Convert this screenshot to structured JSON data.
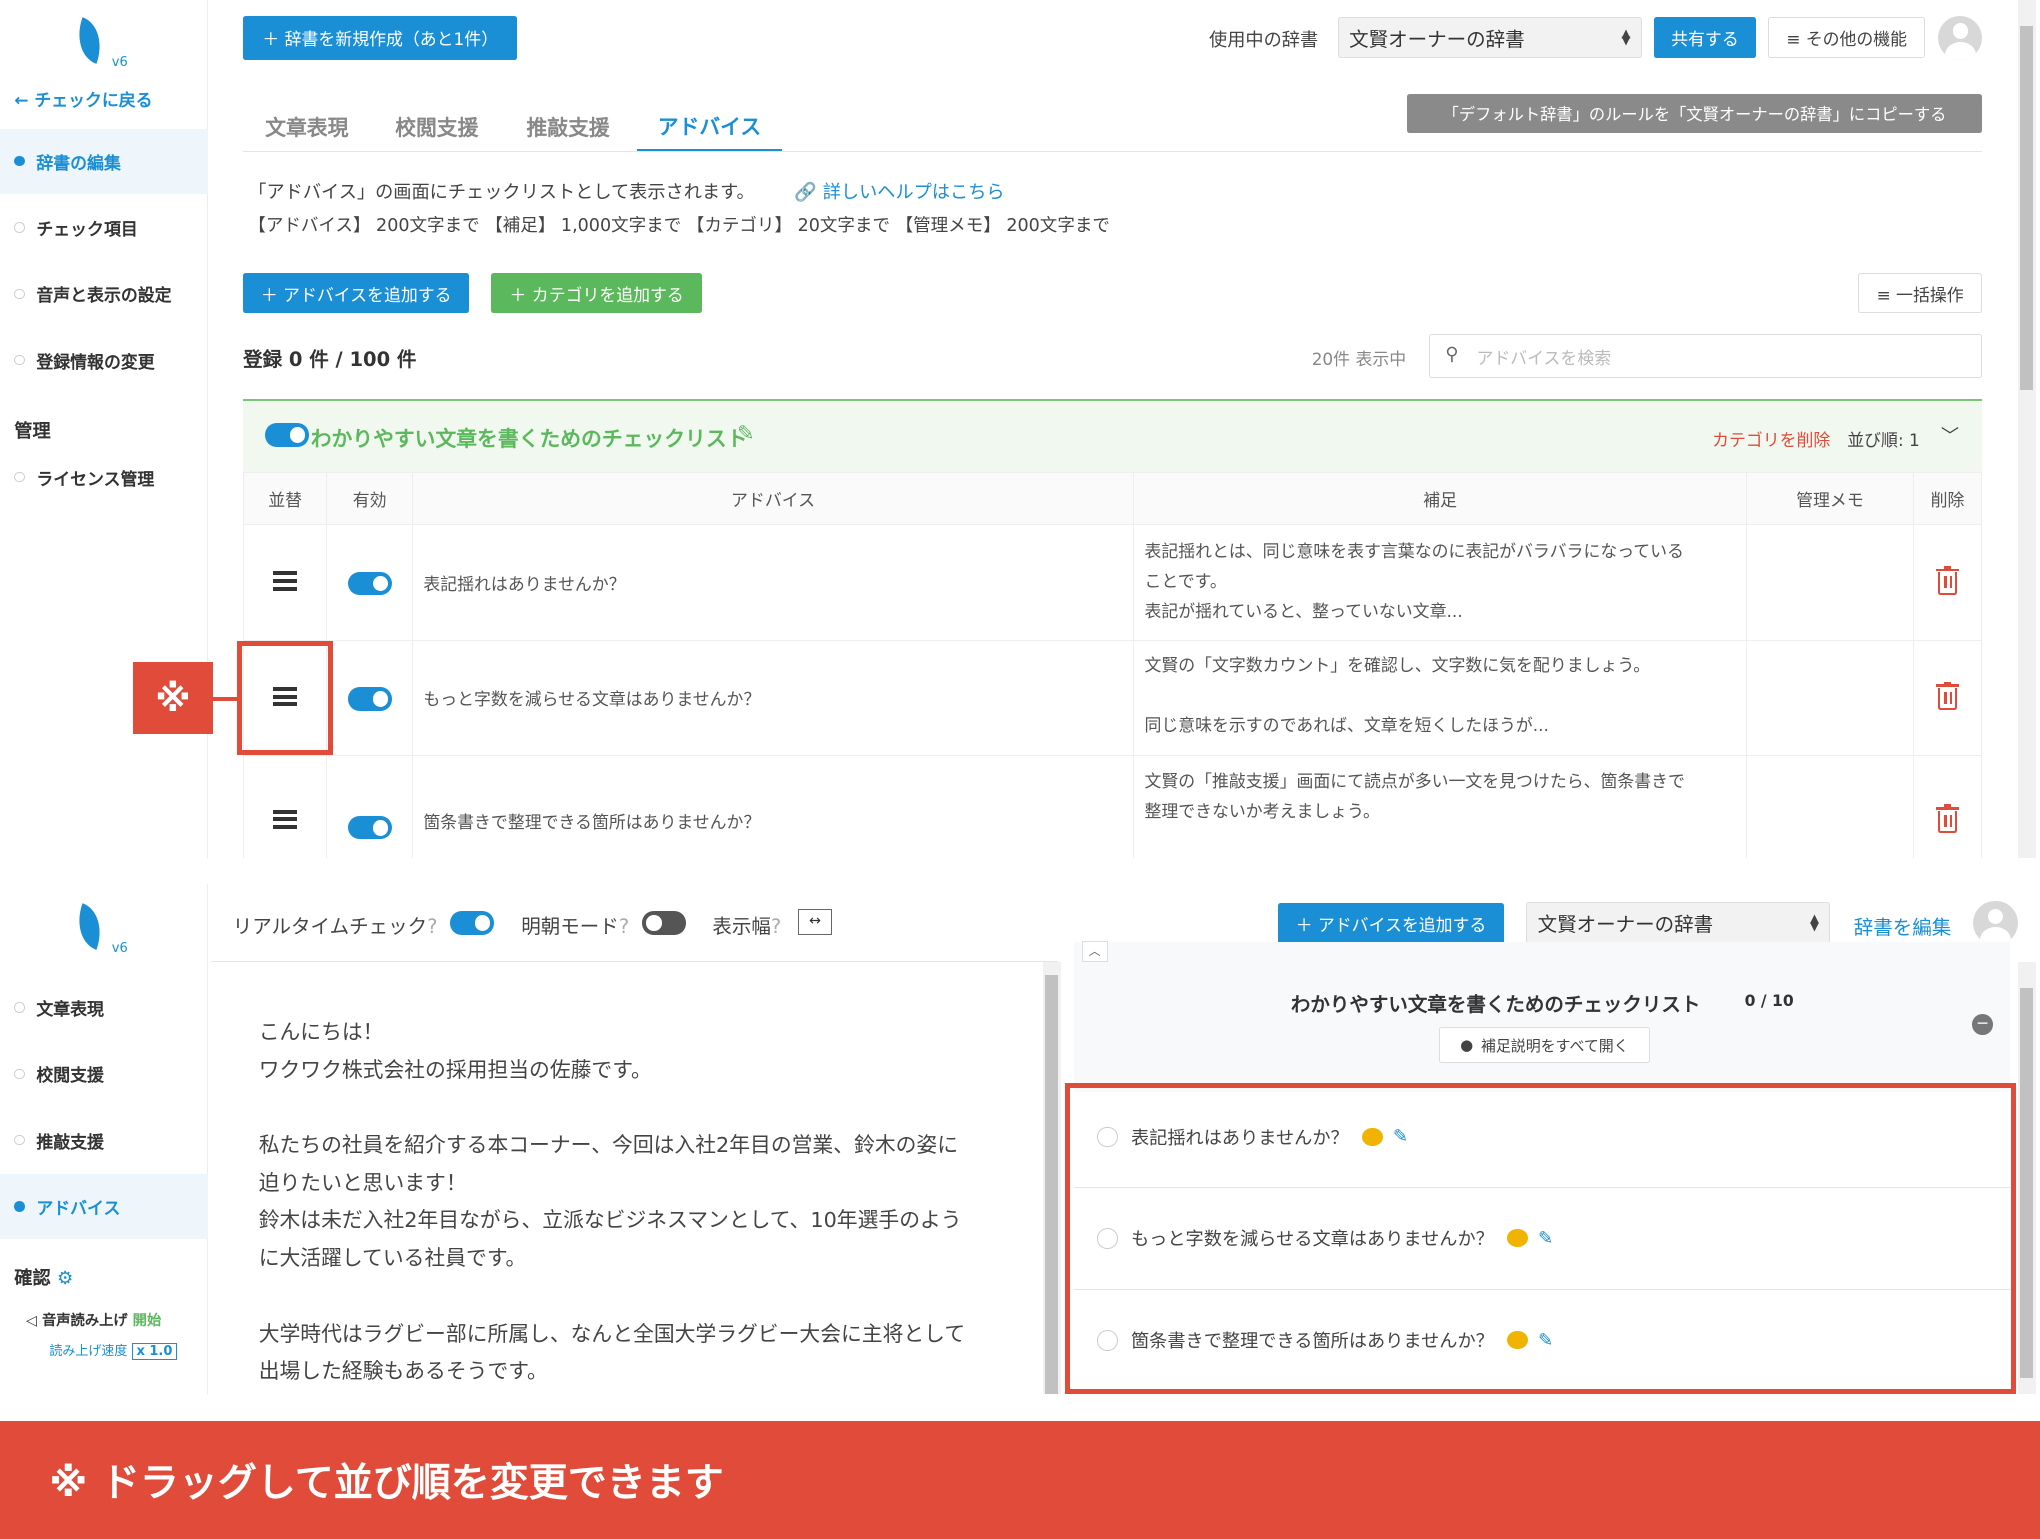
{
  "top": {
    "logo_version": "v6",
    "back_link": "← チェックに戻る",
    "sidebar_items": [
      {
        "label": "辞書の編集",
        "active": true
      },
      {
        "label": "チェック項目",
        "active": false
      },
      {
        "label": "音声と表示の設定",
        "active": false
      },
      {
        "label": "登録情報の変更",
        "active": false
      }
    ],
    "sidebar_manage_heading": "管理",
    "sidebar_license": "ライセンス管理",
    "new_dict_button": "＋ 辞書を新規作成（あと1件）",
    "dict_in_use_label": "使用中の辞書",
    "dict_select_value": "文賢オーナーの辞書",
    "share_button": "共有する",
    "more_button": "≡ その他の機能",
    "tabs": [
      "文章表現",
      "校閲支援",
      "推敲支援",
      "アドバイス"
    ],
    "active_tab": "アドバイス",
    "copy_rules_button": "「デフォルト辞書」のルールを「文賢オーナーの辞書」にコピーする",
    "description": "「アドバイス」の画面にチェックリストとして表示されます。",
    "help_link": "詳しいヘルプはこちら",
    "limits": "【アドバイス】 200文字まで 【補足】 1,000文字まで 【カテゴリ】 20文字まで 【管理メモ】 200文字まで",
    "add_advice_button": "＋ アドバイスを追加する",
    "add_category_button": "＋ カテゴリを追加する",
    "bulk_button": "≡ 一括操作",
    "registered_count": "登録 0 件 / 100 件",
    "showing_count": "20件 表示中",
    "search_placeholder": "アドバイスを検索",
    "category_name": "わかりやすい文章を書くためのチェックリスト",
    "delete_category": "カテゴリを削除",
    "sort_order": "並び順: 1",
    "table_headers": [
      "並替",
      "有効",
      "アドバイス",
      "補足",
      "管理メモ",
      "削除"
    ],
    "rows": [
      {
        "advice": "表記揺れはありませんか？",
        "note_lines": [
          "表記揺れとは、同じ意味を表す言葉なのに表記がバラバラになっている",
          "ことです。",
          "表記が揺れていると、整っていない文章..."
        ]
      },
      {
        "advice": "もっと字数を減らせる文章はありませんか？",
        "note_lines": [
          "文賢の「文字数カウント」を確認し、文字数に気を配りましょう。",
          "",
          "同じ意味を示すのであれば、文章を短くしたほうが..."
        ]
      },
      {
        "advice": "箇条書きで整理できる箇所はありませんか？",
        "note_lines": [
          "文賢の「推敲支援」画面にて読点が多い一文を見つけたら、箇条書きで",
          "整理できないか考えましょう。",
          ""
        ]
      }
    ],
    "marker_symbol": "※"
  },
  "bottom": {
    "logo_version": "v6",
    "sidebar_items": [
      {
        "label": "文章表現",
        "active": false
      },
      {
        "label": "校閲支援",
        "active": false
      },
      {
        "label": "推敲支援",
        "active": false
      },
      {
        "label": "アドバイス",
        "active": true
      }
    ],
    "confirm_heading": "確認",
    "tts_label": "音声読み上げ",
    "tts_start": "開始",
    "tts_speed_label": "読み上げ速度",
    "tts_speed_value": "x 1.0",
    "realtime_label": "リアルタイムチェック",
    "bright_label": "明朝モード",
    "width_label": "表示幅",
    "add_advice_button": "＋ アドバイスを追加する",
    "dict_select_value": "文賢オーナーの辞書",
    "edit_dict_link": "辞書を編集",
    "editor_paragraphs": [
      [
        "こんにちは！",
        "ワクワク株式会社の採用担当の佐藤です。"
      ],
      [
        "私たちの社員を紹介する本コーナー、今回は入社2年目の営業、鈴木の姿に",
        "迫りたいと思います！",
        "鈴木は未だ入社2年目ながら、立派なビジネスマンとして、10年選手のよう",
        "に大活躍している社員です。"
      ],
      [
        "大学時代はラグビー部に所属し、なんと全国大学ラグビー大会に主将として",
        "出場した経験もあるそうです。"
      ]
    ],
    "checklist_title": "わかりやすい文章を書くためのチェックリスト",
    "checklist_count": "0 / 10",
    "expand_all_button": "補足説明をすべて開く",
    "checklist_items": [
      "表記揺れはありませんか？",
      "もっと字数を減らせる文章はありませんか？",
      "箇条書きで整理できる箇所はありませんか？"
    ]
  },
  "banner_text": "※ ドラッグして並び順を変更できます",
  "colors": {
    "accent": "#1a8fd6",
    "green": "#5cb85c",
    "red": "#e04b3a"
  }
}
